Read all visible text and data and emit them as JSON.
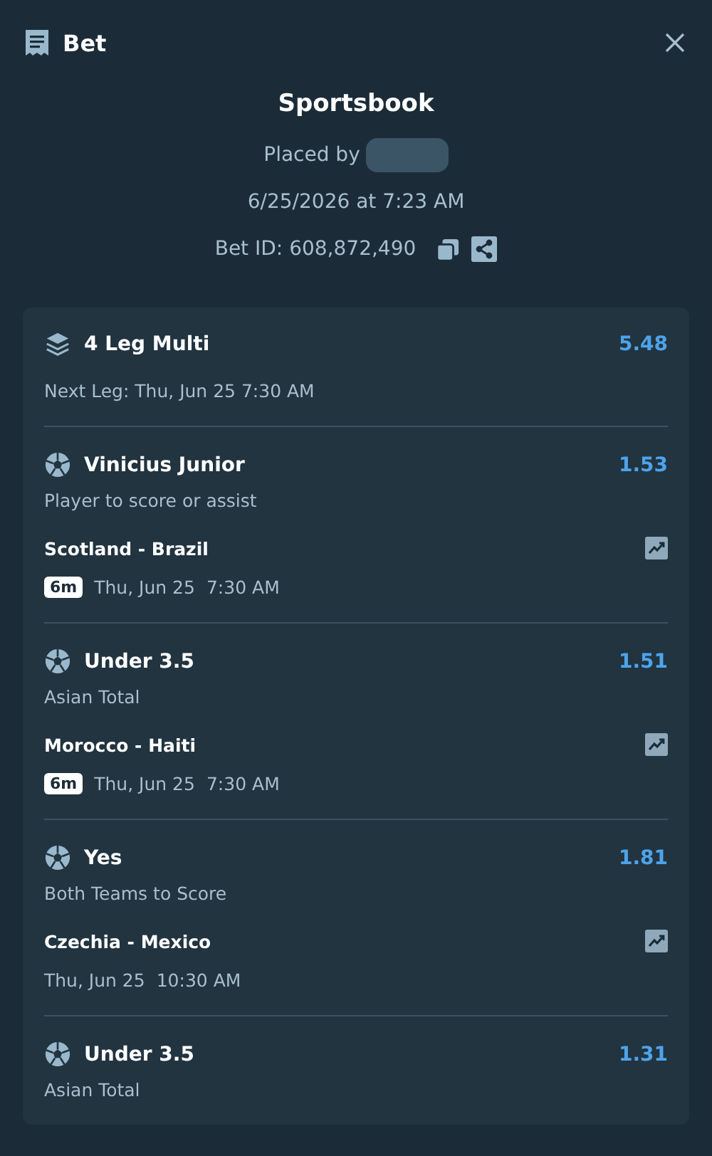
{
  "header": {
    "title": "Bet"
  },
  "summary": {
    "title": "Sportsbook",
    "placed_by": "Placed by",
    "placed_at": "6/25/2026 at 7:23 AM",
    "bet_id": "Bet ID: 608,872,490"
  },
  "multi": {
    "title": "4 Leg Multi",
    "odds": "5.48",
    "next_leg": "Next Leg: Thu, Jun 25 7:30 AM"
  },
  "legs": [
    {
      "selection": "Vinicius Junior",
      "odds": "1.53",
      "market": "Player to score or assist",
      "match": "Scotland - Brazil",
      "badge": "6m",
      "date": "Thu, Jun 25",
      "time": "7:30 AM"
    },
    {
      "selection": "Under 3.5",
      "odds": "1.51",
      "market": "Asian Total",
      "match": "Morocco - Haiti",
      "badge": "6m",
      "date": "Thu, Jun 25",
      "time": "7:30 AM"
    },
    {
      "selection": "Yes",
      "odds": "1.81",
      "market": "Both Teams to Score",
      "match": "Czechia - Mexico",
      "date": "Thu, Jun 25",
      "time": "10:30 AM"
    },
    {
      "selection": "Under 3.5",
      "odds": "1.31",
      "market": "Asian Total"
    }
  ]
}
